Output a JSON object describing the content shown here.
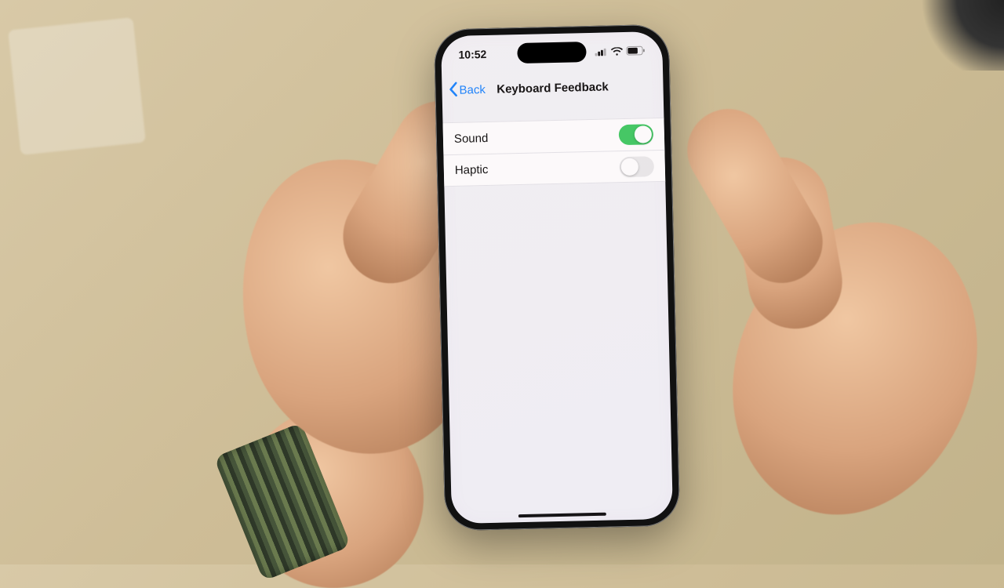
{
  "statusbar": {
    "time": "10:52"
  },
  "nav": {
    "back": "Back",
    "title": "Keyboard Feedback"
  },
  "rows": [
    {
      "label": "Sound",
      "on": true
    },
    {
      "label": "Haptic",
      "on": false
    }
  ]
}
